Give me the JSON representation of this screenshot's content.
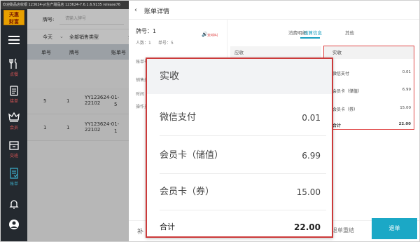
{
  "status_bar": {
    "text": "欢迎甜品店收银  123624-yt生产甜品店   123624-7.6.1.6.9135   release76"
  },
  "sidebar": {
    "logo": {
      "line1": "天惠",
      "line2": "财富"
    },
    "items": [
      {
        "label": "点餐",
        "icon": "fork-knife-icon"
      },
      {
        "label": "接单",
        "icon": "clipboard-icon"
      },
      {
        "label": "会员",
        "icon": "crown-icon"
      },
      {
        "label": "交班",
        "icon": "handover-icon"
      },
      {
        "label": "账单",
        "icon": "bill-icon"
      }
    ],
    "bottom_icons": [
      "bell-icon",
      "user-icon"
    ]
  },
  "list_page": {
    "plate_label": "牌号:",
    "plate_placeholder": "请输入牌号",
    "filters": {
      "date": "今天",
      "sales_type": "全部销售类型",
      "extra": "全"
    },
    "columns": [
      "单号",
      "牌号",
      "账单号"
    ],
    "rows": [
      {
        "no": "5",
        "plate": "1",
        "bill": "YY123624-01-22102",
        "bill2": "5"
      },
      {
        "no": "1",
        "plate": "1",
        "bill": "YY123624-01-22102",
        "bill2": "1"
      }
    ]
  },
  "detail": {
    "back_icon": "chevron-left-icon",
    "title": "账单详情",
    "plate": "牌号：1",
    "people": "人数：1",
    "order_no": "单号：5",
    "unpaid_icon": "speaker-icon",
    "unpaid_text": "未呼叫",
    "left_rows": [
      "账单号",
      "销售类",
      "时间",
      "操作员"
    ],
    "tabs": [
      "消费明细",
      "结算信息",
      "其他"
    ],
    "active_tab": "结算信息",
    "receivable_label": "应收",
    "small_box": {
      "header": "实收",
      "rows": [
        {
          "label": "微信支付",
          "value": "0.01"
        },
        {
          "label": "会员卡（储值）",
          "value": "6.99"
        },
        {
          "label": "会员卡（券）",
          "value": "15.00"
        },
        {
          "label": "合计",
          "value": "22.00"
        }
      ]
    },
    "bottom": {
      "partial_label": "补",
      "anti_settle": "退单重结",
      "refund": "退单"
    }
  },
  "magnified": {
    "header": "实收",
    "rows": [
      {
        "label": "微信支付",
        "value": "0.01"
      },
      {
        "label": "会员卡（储值）",
        "value": "6.99"
      },
      {
        "label": "会员卡（券）",
        "value": "15.00"
      }
    ],
    "total": {
      "label": "合计",
      "value": "22.00"
    }
  }
}
